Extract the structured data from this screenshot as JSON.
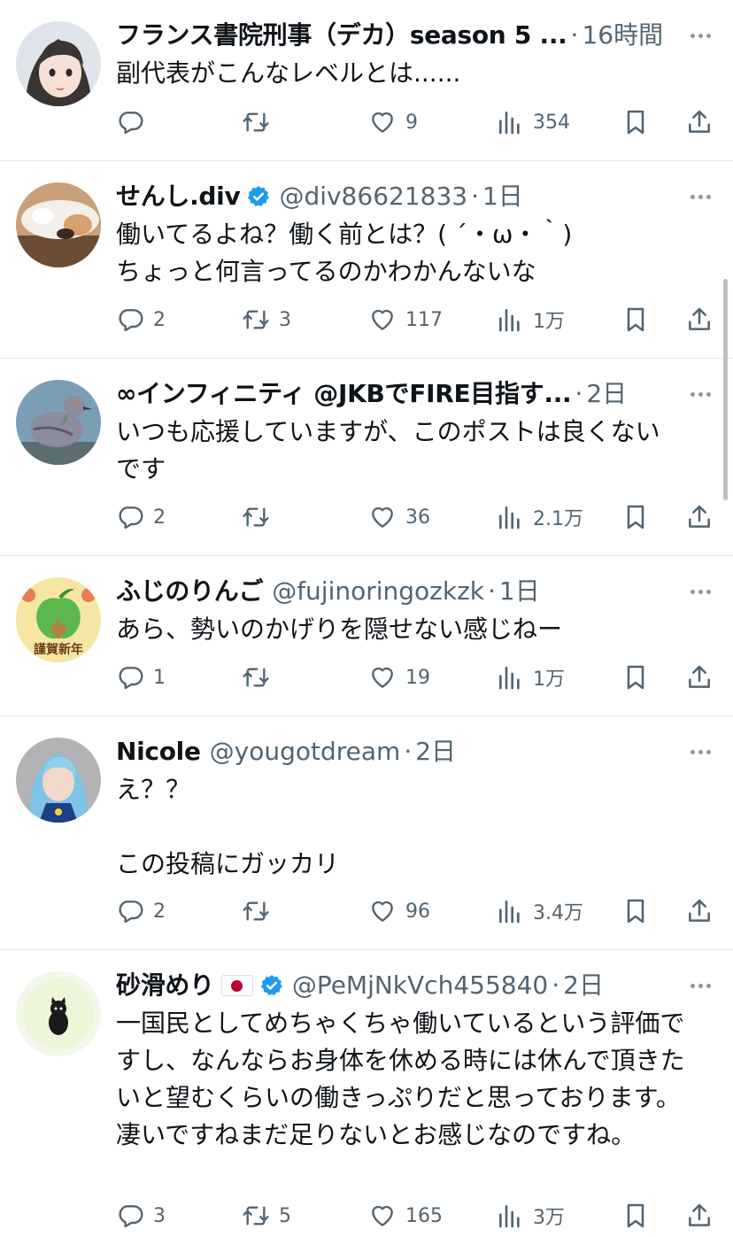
{
  "colors": {
    "text": "#0f1419",
    "secondary": "#536471",
    "verified": "#1d9bf0",
    "divider": "#e6e9ec"
  },
  "tweets": [
    {
      "avatar_icon": "anime-girl-avatar",
      "name": "フランス書院刑事（デカ）season 5 ...",
      "handle": "",
      "time": "16時間",
      "verified": false,
      "body": "副代表がこんなレベルとは......",
      "replies": "",
      "retweets": "",
      "likes": "9",
      "views": "354"
    },
    {
      "avatar_icon": "cat-paw-avatar",
      "name": "せんし.div",
      "handle": "@div86621833",
      "time": "1日",
      "verified": true,
      "body": "働いてるよね？働く前とは？( ´・ω・｀)\nちょっと何言ってるのかわかんないな",
      "replies": "2",
      "retweets": "3",
      "likes": "117",
      "views": "1万"
    },
    {
      "avatar_icon": "pigeon-avatar",
      "name": "∞インフィニティ @JKBでFIRE目指す...",
      "handle": "",
      "time": "2日",
      "verified": false,
      "body": "いつも応援していますが、このポストは良くない\nです",
      "replies": "2",
      "retweets": "",
      "likes": "36",
      "views": "2.1万"
    },
    {
      "avatar_icon": "apple-new-year-avatar",
      "avatar_text": "謹賀新年",
      "name": "ふじのりんご",
      "handle": "@fujinoringozkzk",
      "time": "1日",
      "verified": false,
      "body": "あら、勢いのかげりを隠せない感じねー",
      "replies": "1",
      "retweets": "",
      "likes": "19",
      "views": "1万"
    },
    {
      "avatar_icon": "blue-hair-character-avatar",
      "name": "Nicole",
      "handle": "@yougotdream",
      "time": "2日",
      "verified": false,
      "body": "え？？\n\nこの投稿にガッカリ",
      "replies": "2",
      "retweets": "",
      "likes": "96",
      "views": "3.4万"
    },
    {
      "avatar_icon": "black-cat-avatar",
      "name": "砂滑めり",
      "handle": "@PeMjNkVch455840",
      "time": "2日",
      "verified": true,
      "flag": true,
      "body": "一国民としてめちゃくちゃ働いているという評価ですし、なんならお身体を休める時には休んで頂きたいと望むくらいの働きっぷりだと思っております。\n凄いですねまだ足りないとお感じなのですね。",
      "replies": "3",
      "retweets": "5",
      "likes": "165",
      "views": "3万"
    }
  ]
}
